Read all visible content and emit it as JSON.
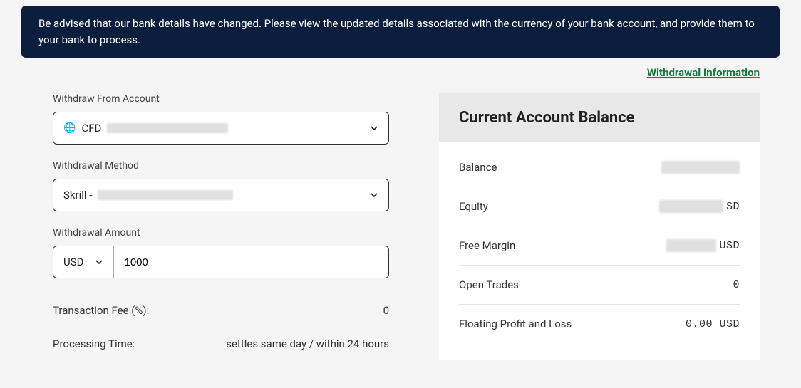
{
  "notice": "Be advised that our bank details have changed. Please view the updated details associated with the currency of your bank account, and provide them to your bank to process.",
  "info_link": "Withdrawal Information",
  "form": {
    "account_label": "Withdraw From Account",
    "account_prefix": "CFD",
    "method_label": "Withdrawal Method",
    "method_prefix": "Skrill - ",
    "amount_label": "Withdrawal Amount",
    "currency": "USD",
    "amount_value": "1000",
    "fee_label": "Transaction Fee (%):",
    "fee_value": "0",
    "processing_label": "Processing Time:",
    "processing_value": "settles same day / within 24 hours"
  },
  "balance": {
    "header": "Current Account Balance",
    "rows": {
      "balance_label": "Balance",
      "equity_label": "Equity",
      "equity_suffix": "SD",
      "free_margin_label": "Free Margin",
      "free_margin_suffix": "USD",
      "open_trades_label": "Open Trades",
      "open_trades_value": "0",
      "floating_label": "Floating Profit and Loss",
      "floating_value": "0.00 USD"
    }
  }
}
